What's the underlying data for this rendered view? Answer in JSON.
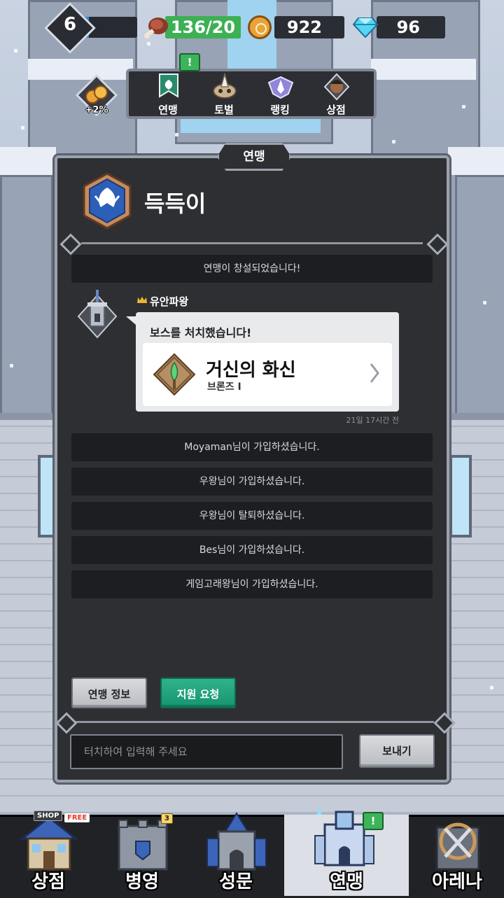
{
  "status": {
    "level": "6",
    "xp_fraction": 0.12,
    "stamina_text": "136/20",
    "stamina_fraction": 1.0,
    "gold": "922",
    "gems": "96"
  },
  "boost": {
    "label": "+2%"
  },
  "top_menu": [
    {
      "label": "연맹",
      "icon": "alliance-banner-icon",
      "badge": "!"
    },
    {
      "label": "토벌",
      "icon": "raid-skull-icon"
    },
    {
      "label": "랭킹",
      "icon": "ranking-wings-icon"
    },
    {
      "label": "상점",
      "icon": "merchant-icon"
    }
  ],
  "panel": {
    "tab_title": "연맹",
    "alliance_name": "득득이"
  },
  "feed": {
    "created_msg": "연맹이 창설되었습니다!",
    "poster": "유안파왕",
    "bubble_title": "보스를 처치했습니다!",
    "boss_name": "거신의 화신",
    "boss_tier": "브론즈 I",
    "timestamp": "21일 17시간 전",
    "messages": [
      "Moyaman님이 가입하셨습니다.",
      "우왕님이 가입하셨습니다.",
      "우왕님이 탈퇴하셨습니다.",
      "Bes님이 가입하셨습니다.",
      "게임고래왕님이 가입하셨습니다."
    ]
  },
  "buttons": {
    "info": "연맹 정보",
    "support": "지원 요청",
    "send": "보내기"
  },
  "chat": {
    "placeholder": "터치하여 입력해 주세요"
  },
  "bottom_nav": [
    {
      "label": "상점",
      "tag": "SHOP",
      "tag2": "FREE"
    },
    {
      "label": "병영",
      "badge": "3"
    },
    {
      "label": "성문"
    },
    {
      "label": "연맹",
      "badge": "!"
    },
    {
      "label": "아레나"
    }
  ],
  "colors": {
    "accent_green": "#189472",
    "xp_blue": "#2e8ad6",
    "stamina_green": "#3db054",
    "panel_bg": "#2e2f33"
  }
}
